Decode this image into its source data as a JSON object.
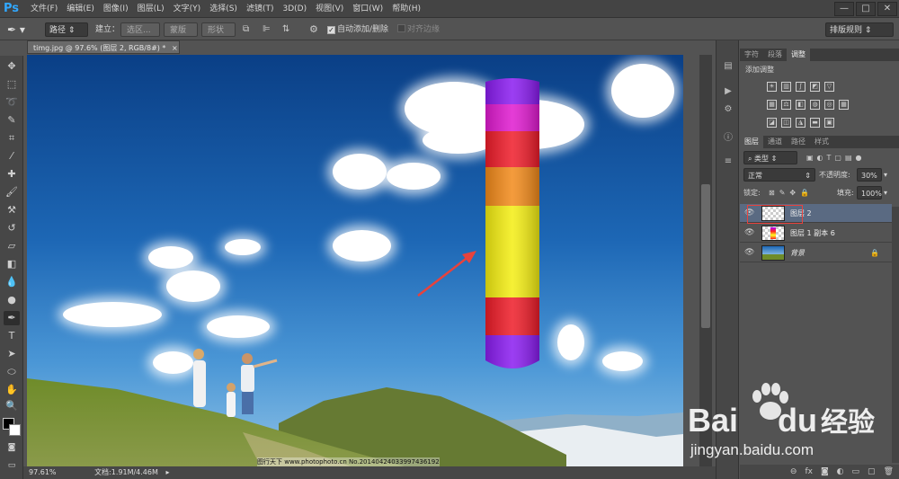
{
  "app": {
    "logo": "Ps"
  },
  "menu": [
    "文件(F)",
    "编辑(E)",
    "图像(I)",
    "图层(L)",
    "文字(Y)",
    "选择(S)",
    "滤镜(T)",
    "3D(D)",
    "视图(V)",
    "窗口(W)",
    "帮助(H)"
  ],
  "window_controls": [
    "—",
    "□",
    "✕"
  ],
  "options": {
    "path_mode": "路径",
    "build_label": "建立：",
    "selection_btn": "选区...",
    "mask_btn": "蒙版",
    "shape_btn": "形状",
    "auto_add_delete": "自动添加/删除",
    "align_edges": "对齐边缘",
    "workspace": "排版规则"
  },
  "document": {
    "tab_title": "timg.jpg @ 97.6% (图层 2, RGB/8#) *",
    "tab_close": "×",
    "watermark_text": "图行天下 www.photophoto.cn No.20140424033997436192"
  },
  "status": {
    "zoom": "97.61%",
    "doc_size": "文档:1.91M/4.46M"
  },
  "panels": {
    "top_tabs": [
      "字符",
      "段落",
      "调整"
    ],
    "adjust_title": "添加调整",
    "layers_tabs": [
      "图层",
      "通道",
      "路径",
      "样式"
    ],
    "filter_kind": "类型",
    "blend_mode": "正常",
    "opacity_label": "不透明度:",
    "opacity_value": "30%",
    "lock_label": "锁定:",
    "fill_label": "填充:",
    "fill_value": "100%",
    "layers": [
      {
        "name": "图层 2",
        "selected": true
      },
      {
        "name": "图层 1 副本 6",
        "selected": false
      },
      {
        "name": "背景",
        "selected": false
      }
    ]
  },
  "watermark": {
    "brand": "Bai",
    "brand2": "du",
    "cn": "经验",
    "url": "jingyan.baidu.com"
  },
  "colors": {
    "accent": "#31a8ff",
    "arrow": "#e8423c",
    "selected_layer": "#5a6a82"
  }
}
